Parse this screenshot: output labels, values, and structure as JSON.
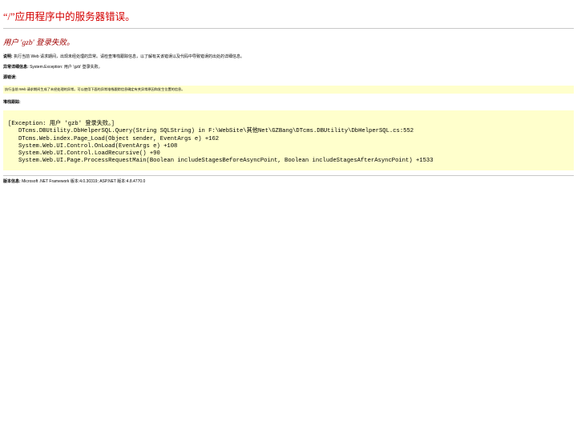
{
  "page_title": "“/”应用程序中的服务器错误。",
  "error_heading": "用户 'gzb' 登录失败。",
  "description": {
    "label": "说明:",
    "text": "执行当前 Web 请求期间，出现未经处理的异常。请检查堆栈跟踪信息，以了解有关该错误以及代码中导致错误的出处的详细信息。"
  },
  "exception_details": {
    "label": "异常详细信息:",
    "text": "System.Exception: 用户 'gzb' 登录失败。"
  },
  "source_error": {
    "label": "源错误:",
    "text": "执行当前 Web 请求期间生成了未经处理的异常。可以使用下面的异常堆栈跟踪信息确定有关异常原因和发生位置的信息。"
  },
  "stack_trace": {
    "label": "堆栈跟踪:",
    "lines": [
      "[Exception: 用户 'gzb' 登录失败。]",
      "   DTcms.DBUtility.DbHelperSQL.Query(String SQLString) in F:\\WebSite\\其他Net\\GZBang\\DTcms.DBUtility\\DbHelperSQL.cs:552",
      "   DTcms.Web.index.Page_Load(Object sender, EventArgs e) +162",
      "   System.Web.UI.Control.OnLoad(EventArgs e) +108",
      "   System.Web.UI.Control.LoadRecursive() +90",
      "   System.Web.UI.Page.ProcessRequestMain(Boolean includeStagesBeforeAsyncPoint, Boolean includeStagesAfterAsyncPoint) +1533"
    ]
  },
  "version_info": {
    "label": "版本信息:",
    "text": "Microsoft .NET Framework 版本:4.0.30319; ASP.NET 版本:4.8.4770.0"
  },
  "colors": {
    "title": "#d40000",
    "heading": "#a00000",
    "highlight_bg": "#ffffcc"
  }
}
